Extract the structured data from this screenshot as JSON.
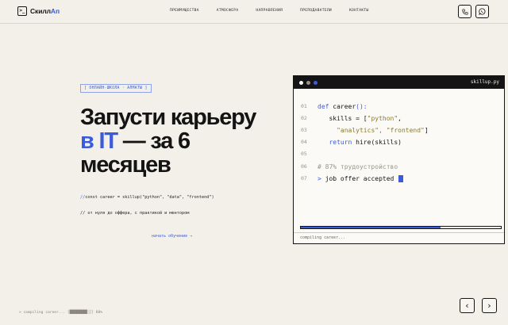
{
  "header": {
    "logo_mark": ">_",
    "brand_main": "Скилл",
    "brand_accent": "Ап",
    "nav": [
      "ПРЕИМУЩЕСТВА",
      "АТМОСФЕРА",
      "НАПРАВЛЕНИЯ",
      "ПРЕПОДАВАТЕЛИ",
      "КОНТАКТЫ"
    ],
    "phone_icon": "phone-icon",
    "whatsapp_icon": "whatsapp-icon"
  },
  "hero": {
    "badge": "[ ОНЛАЙН-ШКОЛА · АЛМАТЫ ]",
    "title_line1": "Запусти карьеру",
    "title_blue": "в IT",
    "title_rest": " — за 6",
    "title_line3": "месяцев",
    "code_prefix": "//",
    "code_text": "const career = skillup(\"python\", \"data\", \"frontend\")",
    "subtitle": "// от нуля до оффера, с практикой и ментором",
    "cta": "начать обучение →"
  },
  "terminal": {
    "filename": "skillup.py",
    "dots": [
      "#ffffff",
      "#9a958b",
      "#3b5bdb"
    ],
    "lines": [
      {
        "n": "01",
        "a": "def",
        "b": " career",
        "c": "():"
      },
      {
        "n": "02",
        "a": "   skills = [",
        "b": "\"python\"",
        "c": ","
      },
      {
        "n": "03",
        "a": "     ",
        "b": "\"analytics\", \"frontend\"",
        "c": "]"
      },
      {
        "n": "04",
        "a": "   ",
        "b": "return",
        "c": " hire(skills)"
      },
      {
        "n": "05",
        "a": "",
        "b": "",
        "c": ""
      },
      {
        "n": "06",
        "a": "# 87% трудоустройство",
        "b": "",
        "c": ""
      },
      {
        "n": "07",
        "a": "> ",
        "b": "job offer accepted",
        "c": ""
      }
    ],
    "progress": 0.7,
    "status": "compiling career..."
  },
  "footer": {
    "status": "> compiling career... [████████░░] 80%",
    "prev": "‹",
    "next": "›"
  },
  "colors": {
    "accent": "#3b5bdb",
    "background": "#f3f0e9",
    "ink": "#141414"
  }
}
